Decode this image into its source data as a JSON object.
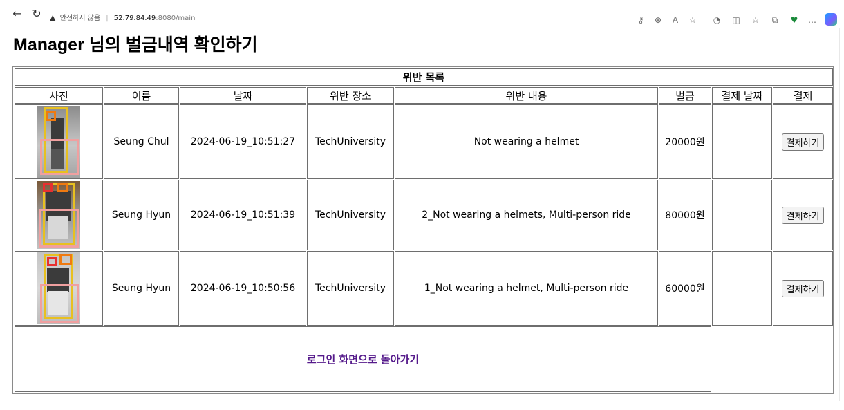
{
  "browser": {
    "security_label": "안전하지 않음",
    "url_host": "52.79.84.49",
    "url_rest": ":8080/main"
  },
  "page": {
    "title": "Manager 님의 벌금내역 확인하기"
  },
  "table": {
    "caption": "위반 목록",
    "headers": [
      "사진",
      "이름",
      "날짜",
      "위반 장소",
      "위반 내용",
      "벌금",
      "결제 날짜",
      "결제"
    ],
    "rows": [
      {
        "name": "Seung Chul",
        "date": "2024-06-19_10:51:27",
        "location": "TechUniversity",
        "violation": "Not wearing a helmet",
        "fine": "20000원",
        "payment_date": "",
        "pay_button": "결제하기"
      },
      {
        "name": "Seung Hyun",
        "date": "2024-06-19_10:51:39",
        "location": "TechUniversity",
        "violation": "2_Not wearing a helmets, Multi-person ride",
        "fine": "80000원",
        "payment_date": "",
        "pay_button": "결제하기"
      },
      {
        "name": "Seung Hyun",
        "date": "2024-06-19_10:50:56",
        "location": "TechUniversity",
        "violation": "1_Not wearing a helmet, Multi-person ride",
        "fine": "60000원",
        "payment_date": "",
        "pay_button": "결제하기"
      }
    ],
    "back_link": "로그인 화면으로 돌아가기"
  },
  "colors": {
    "box_yellow": "#e8c020",
    "box_orange": "#f07a10",
    "box_red": "#e83030",
    "box_pink": "#f0a0a0",
    "link_visited": "#551a8b"
  },
  "icons": [
    "back-arrow-icon",
    "refresh-icon",
    "warning-icon",
    "key-icon",
    "zoom-icon",
    "read-aloud-icon",
    "favorite-star-icon",
    "extensions-icon",
    "split-screen-icon",
    "favorites-icon",
    "collections-icon",
    "browser-essentials-icon",
    "more-icon",
    "copilot-icon"
  ]
}
